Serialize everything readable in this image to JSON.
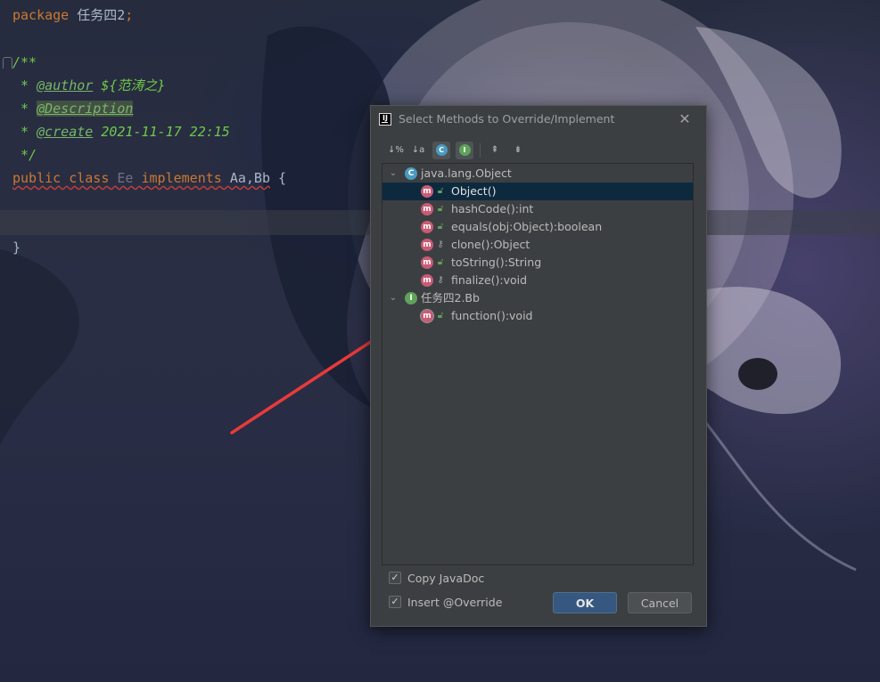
{
  "editor": {
    "line1": {
      "keyword": "package",
      "name": "任务四2",
      "semi": ";"
    },
    "doc_open": "/**",
    "doc_author": {
      "prefix": " * ",
      "tag": "@author",
      "value": " ${范涛之}"
    },
    "doc_description": {
      "prefix": " * ",
      "tag": "@Description"
    },
    "doc_create": {
      "prefix": " * ",
      "tag": "@create",
      "value": " 2021-11-17 22:15"
    },
    "doc_close": " */",
    "class_line": {
      "kw_public": "public",
      "kw_class": "class",
      "class_name": "Ee",
      "kw_implements": "implements",
      "interfaces": "Aa,Bb",
      "brace_open": "{"
    },
    "brace_close": "}"
  },
  "dialog": {
    "title": "Select Methods to Override/Implement",
    "close_glyph": "✕",
    "toolbar": {
      "sort_by_visibility": "↓%",
      "sort_alpha": "↓a z",
      "show_classes": "C",
      "show_interfaces": "I",
      "expand_all": "⇞",
      "collapse_all": "⇟"
    },
    "tree": [
      {
        "kind": "class",
        "icon": "C",
        "label": "java.lang.Object",
        "expanded": true,
        "children": [
          {
            "label": "Object()",
            "visibility": "public",
            "selected": true
          },
          {
            "label": "hashCode():int",
            "visibility": "public"
          },
          {
            "label": "equals(obj:Object):boolean",
            "visibility": "public"
          },
          {
            "label": "clone():Object",
            "visibility": "protected"
          },
          {
            "label": "toString():String",
            "visibility": "public"
          },
          {
            "label": "finalize():void",
            "visibility": "protected"
          }
        ]
      },
      {
        "kind": "interface",
        "icon": "I",
        "label": "任务四2.Bb",
        "expanded": true,
        "children": [
          {
            "label": "function():void",
            "visibility": "public",
            "abstract": true
          }
        ]
      }
    ],
    "copy_javadoc": {
      "label": "Copy JavaDoc",
      "checked": true
    },
    "insert_override": {
      "label": "Insert @Override",
      "checked": true
    },
    "ok_label": "OK",
    "cancel_label": "Cancel"
  },
  "colors": {
    "keyword": "#cc7832",
    "doc_comment": "#6fc84a",
    "selection": "#0d293e",
    "ok_button": "#365880",
    "annotation_arrow": "#e83a3a"
  }
}
